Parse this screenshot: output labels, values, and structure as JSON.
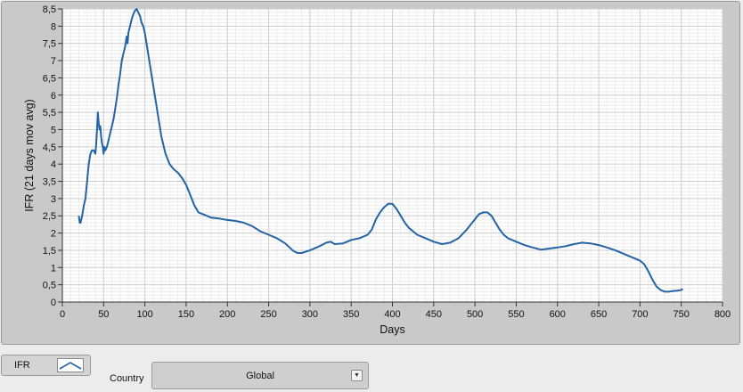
{
  "chart_data": {
    "type": "line",
    "xlabel": "Days",
    "ylabel": "IFR  (21 days mov avg)",
    "xlim": [
      0,
      800
    ],
    "ylim": [
      0,
      8.5
    ],
    "x_ticks": [
      0,
      50,
      100,
      150,
      200,
      250,
      300,
      350,
      400,
      450,
      500,
      550,
      600,
      650,
      700,
      750,
      800
    ],
    "y_ticks": [
      "0",
      "0,5",
      "1",
      "1,5",
      "2",
      "2,5",
      "3",
      "3,5",
      "4",
      "4,5",
      "5",
      "5,5",
      "6",
      "6,5",
      "7",
      "7,5",
      "8",
      "8,5"
    ],
    "grid": true,
    "line_color": "#2463a4",
    "series": [
      {
        "name": "IFR",
        "x": [
          20,
          21,
          22,
          24,
          26,
          28,
          30,
          32,
          34,
          36,
          38,
          40,
          41,
          42,
          43,
          44,
          45,
          46,
          47,
          48,
          49,
          50,
          51,
          52,
          54,
          56,
          58,
          60,
          62,
          64,
          66,
          68,
          70,
          72,
          74,
          76,
          78,
          79,
          80,
          81,
          82,
          84,
          86,
          88,
          90,
          91,
          92,
          93,
          94,
          95,
          96,
          98,
          100,
          102,
          104,
          106,
          108,
          110,
          112,
          114,
          116,
          118,
          120,
          125,
          130,
          135,
          140,
          145,
          150,
          155,
          160,
          165,
          170,
          175,
          180,
          190,
          200,
          210,
          220,
          230,
          240,
          250,
          260,
          270,
          280,
          285,
          290,
          300,
          310,
          320,
          325,
          330,
          340,
          345,
          350,
          360,
          370,
          375,
          380,
          385,
          390,
          395,
          400,
          405,
          410,
          415,
          420,
          430,
          440,
          450,
          460,
          470,
          480,
          490,
          500,
          505,
          510,
          515,
          520,
          525,
          530,
          535,
          540,
          545,
          550,
          560,
          570,
          580,
          590,
          600,
          610,
          620,
          630,
          640,
          650,
          660,
          670,
          680,
          690,
          700,
          705,
          710,
          715,
          720,
          725,
          730,
          735,
          740,
          745,
          750,
          752
        ],
        "values": [
          2.5,
          2.3,
          2.3,
          2.5,
          2.8,
          3.0,
          3.5,
          4.0,
          4.3,
          4.4,
          4.4,
          4.3,
          4.6,
          5.0,
          5.5,
          5.2,
          5.0,
          5.1,
          4.8,
          4.6,
          4.5,
          4.3,
          4.5,
          4.4,
          4.5,
          4.7,
          4.9,
          5.1,
          5.3,
          5.6,
          5.9,
          6.3,
          6.6,
          7.0,
          7.2,
          7.4,
          7.7,
          7.5,
          7.8,
          7.9,
          8.0,
          8.2,
          8.35,
          8.45,
          8.5,
          8.45,
          8.4,
          8.35,
          8.3,
          8.2,
          8.1,
          8.0,
          7.8,
          7.5,
          7.2,
          6.9,
          6.6,
          6.3,
          6.0,
          5.7,
          5.4,
          5.1,
          4.8,
          4.3,
          4.0,
          3.85,
          3.75,
          3.6,
          3.4,
          3.1,
          2.8,
          2.6,
          2.55,
          2.5,
          2.45,
          2.42,
          2.38,
          2.35,
          2.3,
          2.2,
          2.05,
          1.95,
          1.85,
          1.7,
          1.48,
          1.42,
          1.42,
          1.5,
          1.6,
          1.72,
          1.75,
          1.68,
          1.7,
          1.75,
          1.8,
          1.85,
          1.95,
          2.1,
          2.4,
          2.6,
          2.75,
          2.85,
          2.85,
          2.7,
          2.5,
          2.3,
          2.15,
          1.95,
          1.85,
          1.75,
          1.68,
          1.72,
          1.85,
          2.1,
          2.4,
          2.55,
          2.6,
          2.6,
          2.5,
          2.3,
          2.1,
          1.95,
          1.85,
          1.8,
          1.75,
          1.65,
          1.58,
          1.52,
          1.55,
          1.58,
          1.62,
          1.68,
          1.72,
          1.7,
          1.65,
          1.58,
          1.5,
          1.4,
          1.3,
          1.2,
          1.1,
          0.9,
          0.65,
          0.45,
          0.35,
          0.3,
          0.3,
          0.32,
          0.33,
          0.35,
          0.38
        ]
      }
    ]
  },
  "legend": {
    "label": "IFR"
  },
  "country": {
    "label": "Country",
    "selected": "Global"
  }
}
